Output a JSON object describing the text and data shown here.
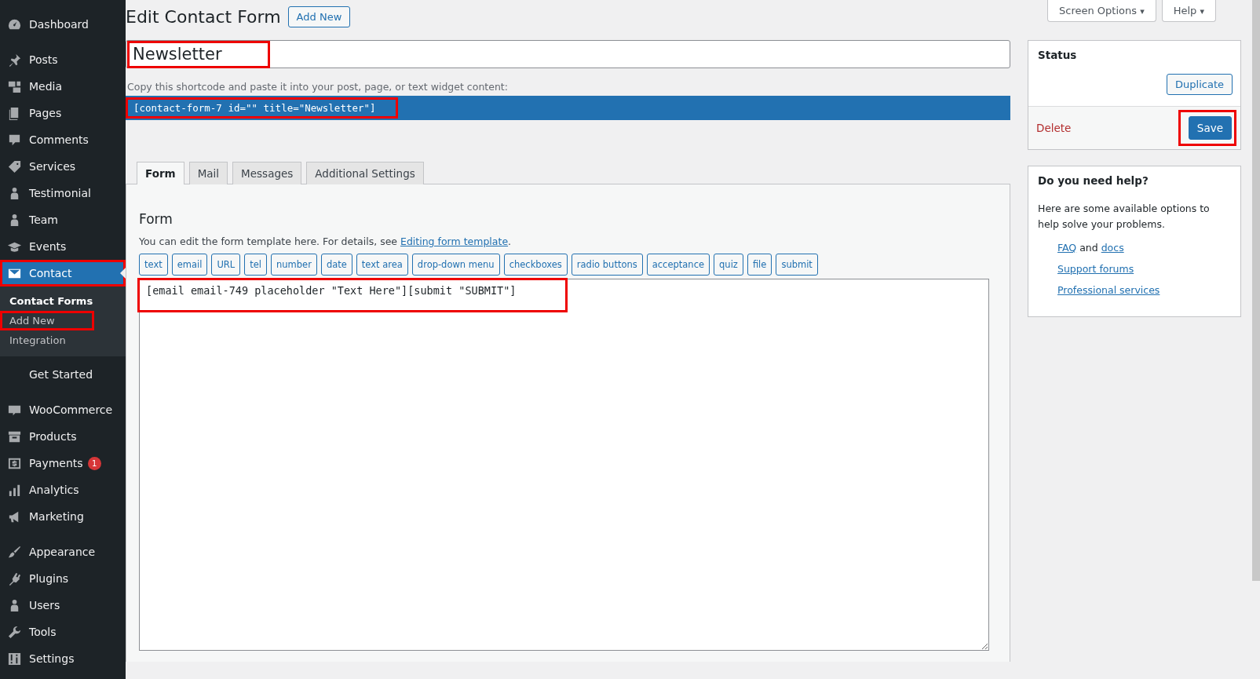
{
  "sidebar": {
    "groups": [
      {
        "items": [
          {
            "label": "Dashboard",
            "current": false
          }
        ]
      },
      {
        "items": [
          {
            "label": "Posts",
            "current": false
          },
          {
            "label": "Media",
            "current": false
          },
          {
            "label": "Pages",
            "current": false
          },
          {
            "label": "Comments",
            "current": false
          },
          {
            "label": "Services",
            "current": false
          },
          {
            "label": "Testimonial",
            "current": false
          },
          {
            "label": "Team",
            "current": false
          },
          {
            "label": "Events",
            "current": false
          },
          {
            "label": "Contact",
            "current": true,
            "highlighted": true,
            "submenu": [
              {
                "label": "Contact Forms",
                "selected": true,
                "highlighted": false
              },
              {
                "label": "Add New",
                "selected": false,
                "highlighted": true
              },
              {
                "label": "Integration",
                "selected": false,
                "highlighted": false
              }
            ]
          },
          {
            "label": "Get Started",
            "current": false
          }
        ]
      },
      {
        "items": [
          {
            "label": "WooCommerce",
            "current": false
          },
          {
            "label": "Products",
            "current": false
          },
          {
            "label": "Payments",
            "current": false,
            "badge": "1"
          },
          {
            "label": "Analytics",
            "current": false
          },
          {
            "label": "Marketing",
            "current": false
          }
        ]
      },
      {
        "items": [
          {
            "label": "Appearance",
            "current": false
          },
          {
            "label": "Plugins",
            "current": false
          },
          {
            "label": "Users",
            "current": false
          },
          {
            "label": "Tools",
            "current": false
          },
          {
            "label": "Settings",
            "current": false
          }
        ]
      }
    ]
  },
  "screen_meta": [
    {
      "label": "Screen Options",
      "caret": "▾"
    },
    {
      "label": "Help",
      "caret": "▾"
    }
  ],
  "heading": {
    "title": "Edit Contact Form",
    "add_new": "Add New"
  },
  "title_field": {
    "value": "Newsletter",
    "highlighted": true
  },
  "shortcode": {
    "hint": "Copy this shortcode and paste it into your post, page, or text widget content:",
    "code": "[contact-form-7 id=\"\" title=\"Newsletter\"]",
    "highlighted": true
  },
  "tabs": [
    {
      "label": "Form",
      "selected": true
    },
    {
      "label": "Mail",
      "selected": false
    },
    {
      "label": "Messages",
      "selected": false
    },
    {
      "label": "Additional Settings",
      "selected": false
    }
  ],
  "form_panel": {
    "title": "Form",
    "description": "You can edit the form template here. For details, see ",
    "link": "Editing form template",
    "after_link": ".",
    "tag_buttons": [
      "text",
      "email",
      "URL",
      "tel",
      "number",
      "date",
      "text area",
      "drop-down menu",
      "checkboxes",
      "radio buttons",
      "acceptance",
      "quiz",
      "file",
      "submit"
    ],
    "template": "[email email-749 placeholder \"Text Here\"][submit \"SUBMIT\"]",
    "template_highlighted": true
  },
  "status_box": {
    "title": "Status",
    "duplicate": "Duplicate",
    "delete": "Delete",
    "save": "Save",
    "save_highlighted": true
  },
  "help_box": {
    "title": "Do you need help?",
    "text": "Here are some available options to help solve your problems.",
    "links": [
      {
        "parts": [
          {
            "kind": "link",
            "text": "FAQ"
          },
          {
            "kind": "text",
            "text": " and "
          },
          {
            "kind": "link",
            "text": "docs"
          }
        ]
      },
      {
        "parts": [
          {
            "kind": "link",
            "text": "Support forums"
          }
        ]
      },
      {
        "parts": [
          {
            "kind": "link",
            "text": "Professional services"
          }
        ]
      }
    ]
  }
}
